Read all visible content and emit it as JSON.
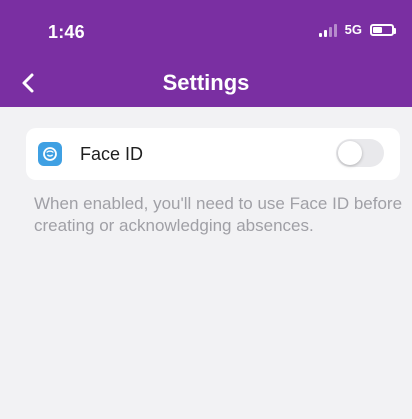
{
  "status_bar": {
    "time": "1:46",
    "network": "5G",
    "battery_fraction": 0.5
  },
  "nav": {
    "title": "Settings",
    "back_icon": "chevron-left-icon"
  },
  "settings": {
    "face_id": {
      "label": "Face ID",
      "icon": "face-id-icon",
      "enabled": false
    },
    "help_text": "When enabled, you'll need to use Face ID before creating or acknowledging absences."
  },
  "colors": {
    "header": "#7a2fa2",
    "face_id_icon": "#3fa0e3",
    "toggle_off": "#e9e9ec",
    "background": "#f2f2f4"
  }
}
